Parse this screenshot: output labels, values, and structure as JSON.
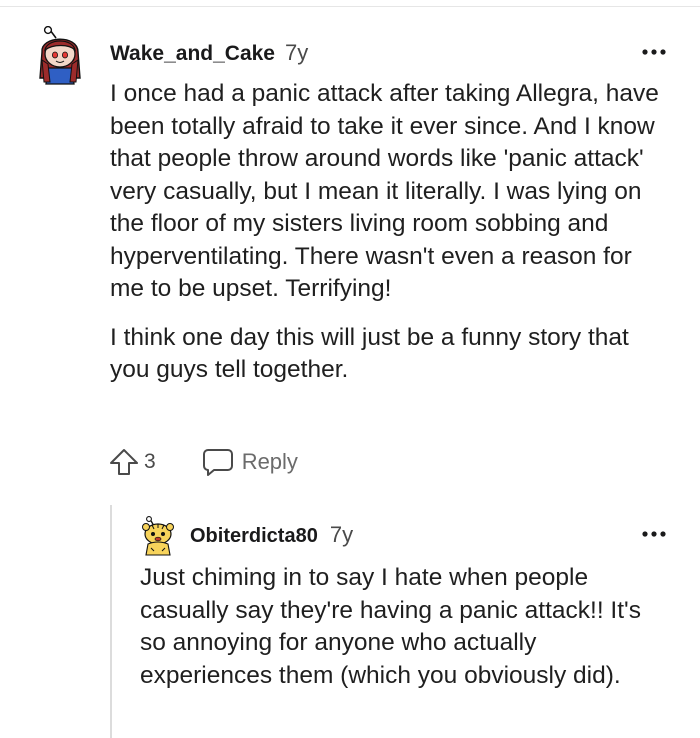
{
  "comments": [
    {
      "username": "Wake_and_Cake",
      "age": "7y",
      "paragraphs": [
        "I once had a panic attack after taking Allegra, have been totally afraid to take it ever since. And I know that people throw around words like 'panic attack' very casually, but I mean it literally. I was lying on the floor of my sisters living room sobbing and hyperventilating. There wasn't even a reason for me to be upset. Terrifying!",
        "I think one day this will just be a funny story that you guys tell together."
      ],
      "votes": "3",
      "reply_label": "Reply",
      "avatar_icon": "red-haired-snoo-avatar"
    },
    {
      "username": "Obiterdicta80",
      "age": "7y",
      "paragraphs": [
        "Just chiming in to say I hate when people casually say they're having a panic attack!! It's so annoying for anyone who actually experiences them (which you obviously did)."
      ],
      "avatar_icon": "yellow-snoo-avatar"
    }
  ],
  "icons": {
    "more": "more-options-icon",
    "upvote": "upvote-arrow-icon",
    "reply": "speech-bubble-icon"
  },
  "colors": {
    "text": "#1a1a1b",
    "muted": "#6b6b6b",
    "thread_line": "#dcdcdc"
  }
}
